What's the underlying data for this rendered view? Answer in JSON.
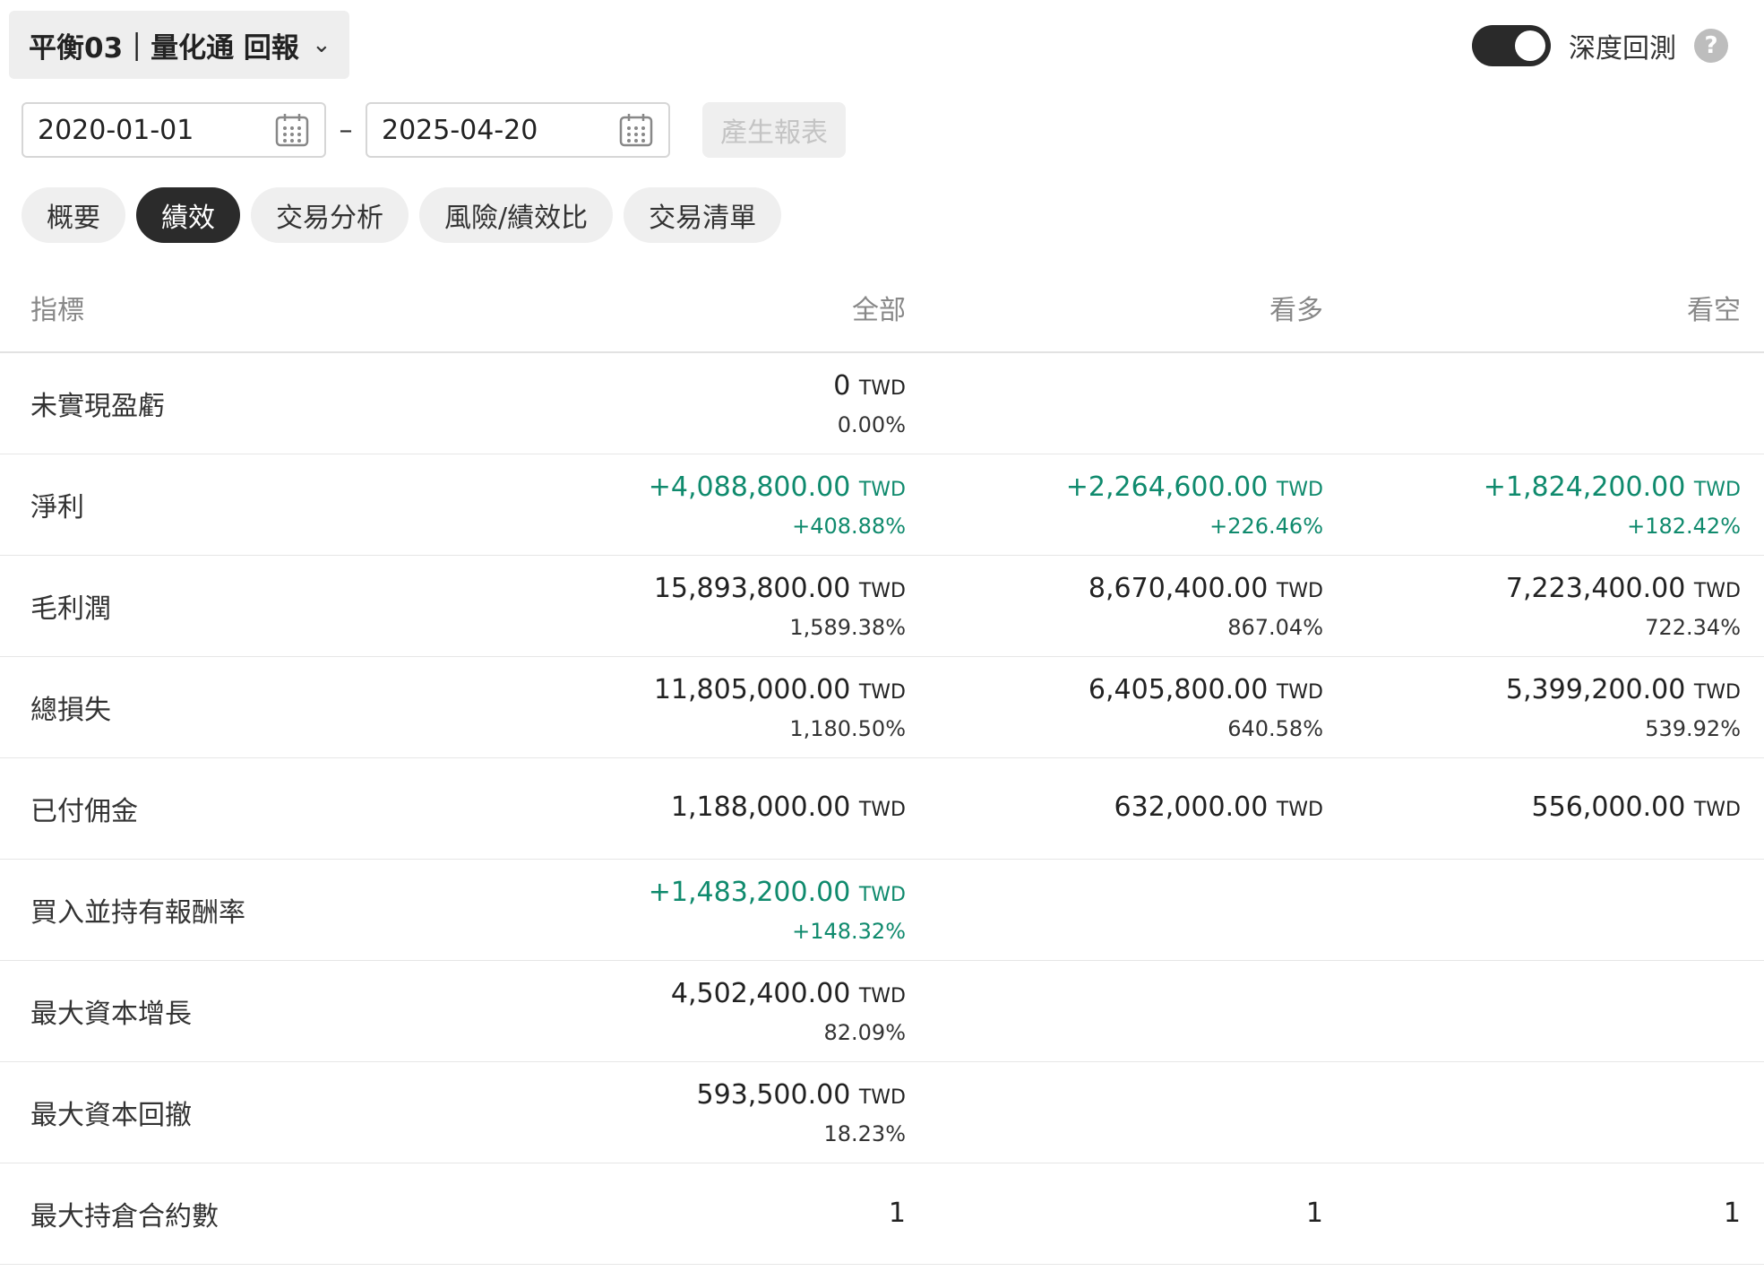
{
  "header": {
    "strategy_title": "平衡03｜量化通 回報",
    "deep_backtest_label": "深度回測",
    "deep_backtest_enabled": true,
    "help_icon": "?"
  },
  "dates": {
    "start": "2020-01-01",
    "separator": "–",
    "end": "2025-04-20",
    "generate_label": "產生報表"
  },
  "tabs": [
    {
      "label": "概要",
      "active": false
    },
    {
      "label": "績效",
      "active": true
    },
    {
      "label": "交易分析",
      "active": false
    },
    {
      "label": "風險/績效比",
      "active": false
    },
    {
      "label": "交易清單",
      "active": false
    }
  ],
  "table": {
    "headers": [
      "指標",
      "全部",
      "看多",
      "看空"
    ],
    "rows": [
      {
        "metric": "未實現盈虧",
        "all": {
          "value": "0",
          "cur": "TWD",
          "pct": "0.00%",
          "positive": false
        },
        "long": {
          "value": "",
          "cur": "",
          "pct": "",
          "positive": false
        },
        "short": {
          "value": "",
          "cur": "",
          "pct": "",
          "positive": false
        }
      },
      {
        "metric": "淨利",
        "all": {
          "value": "+4,088,800.00",
          "cur": "TWD",
          "pct": "+408.88%",
          "positive": true
        },
        "long": {
          "value": "+2,264,600.00",
          "cur": "TWD",
          "pct": "+226.46%",
          "positive": true
        },
        "short": {
          "value": "+1,824,200.00",
          "cur": "TWD",
          "pct": "+182.42%",
          "positive": true
        }
      },
      {
        "metric": "毛利潤",
        "all": {
          "value": "15,893,800.00",
          "cur": "TWD",
          "pct": "1,589.38%",
          "positive": false
        },
        "long": {
          "value": "8,670,400.00",
          "cur": "TWD",
          "pct": "867.04%",
          "positive": false
        },
        "short": {
          "value": "7,223,400.00",
          "cur": "TWD",
          "pct": "722.34%",
          "positive": false
        }
      },
      {
        "metric": "總損失",
        "all": {
          "value": "11,805,000.00",
          "cur": "TWD",
          "pct": "1,180.50%",
          "positive": false
        },
        "long": {
          "value": "6,405,800.00",
          "cur": "TWD",
          "pct": "640.58%",
          "positive": false
        },
        "short": {
          "value": "5,399,200.00",
          "cur": "TWD",
          "pct": "539.92%",
          "positive": false
        }
      },
      {
        "metric": "已付佣金",
        "all": {
          "value": "1,188,000.00",
          "cur": "TWD",
          "pct": "",
          "positive": false
        },
        "long": {
          "value": "632,000.00",
          "cur": "TWD",
          "pct": "",
          "positive": false
        },
        "short": {
          "value": "556,000.00",
          "cur": "TWD",
          "pct": "",
          "positive": false
        }
      },
      {
        "metric": "買入並持有報酬率",
        "all": {
          "value": "+1,483,200.00",
          "cur": "TWD",
          "pct": "+148.32%",
          "positive": true
        },
        "long": {
          "value": "",
          "cur": "",
          "pct": "",
          "positive": false
        },
        "short": {
          "value": "",
          "cur": "",
          "pct": "",
          "positive": false
        }
      },
      {
        "metric": "最大資本增長",
        "all": {
          "value": "4,502,400.00",
          "cur": "TWD",
          "pct": "82.09%",
          "positive": false
        },
        "long": {
          "value": "",
          "cur": "",
          "pct": "",
          "positive": false
        },
        "short": {
          "value": "",
          "cur": "",
          "pct": "",
          "positive": false
        }
      },
      {
        "metric": "最大資本回撤",
        "all": {
          "value": "593,500.00",
          "cur": "TWD",
          "pct": "18.23%",
          "positive": false
        },
        "long": {
          "value": "",
          "cur": "",
          "pct": "",
          "positive": false
        },
        "short": {
          "value": "",
          "cur": "",
          "pct": "",
          "positive": false
        }
      },
      {
        "metric": "最大持倉合約數",
        "all": {
          "value": "1",
          "cur": "",
          "pct": "",
          "positive": false
        },
        "long": {
          "value": "1",
          "cur": "",
          "pct": "",
          "positive": false
        },
        "short": {
          "value": "1",
          "cur": "",
          "pct": "",
          "positive": false
        }
      }
    ]
  }
}
